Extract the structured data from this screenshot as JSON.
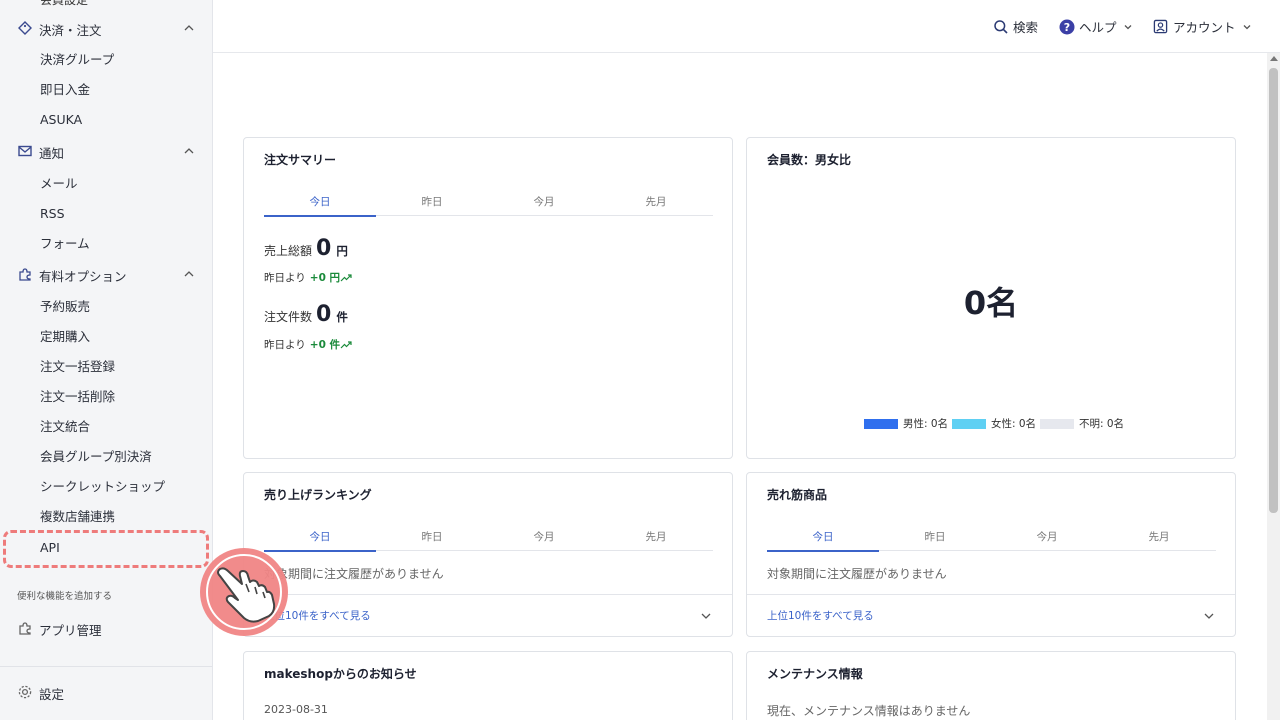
{
  "sidebar": {
    "cut_top_label": "会員設定",
    "sections": [
      {
        "label": "決済・注文",
        "icon": "tag-icon",
        "items": [
          "決済グループ",
          "即日入金",
          "ASUKA"
        ]
      },
      {
        "label": "通知",
        "icon": "mail-icon",
        "items": [
          "メール",
          "RSS",
          "フォーム"
        ]
      },
      {
        "label": "有料オプション",
        "icon": "puzzle-icon",
        "items": [
          "予約販売",
          "定期購入",
          "注文一括登録",
          "注文一括削除",
          "注文統合",
          "会員グループ別決済",
          "シークレットショップ",
          "複数店舗連携",
          "API"
        ]
      }
    ],
    "note": "便利な機能を追加する",
    "app_manage": "アプリ管理",
    "settings": "設定"
  },
  "header": {
    "search": "検索",
    "help": "ヘルプ",
    "account": "アカウント"
  },
  "order_summary": {
    "title": "注文サマリー",
    "tabs": [
      "今日",
      "昨日",
      "今月",
      "先月"
    ],
    "sales_label": "売上総額",
    "sales_value": "0",
    "sales_unit": "円",
    "sales_delta_prefix": "昨日より",
    "sales_delta": "+0 円",
    "orders_label": "注文件数",
    "orders_value": "0",
    "orders_unit": "件",
    "orders_delta_prefix": "昨日より",
    "orders_delta": "+0 件"
  },
  "members": {
    "title": "会員数：男女比",
    "total": "0名",
    "legend": [
      {
        "label": "男性: 0名",
        "color": "#2f6fee"
      },
      {
        "label": "女性: 0名",
        "color": "#5fd0f3"
      },
      {
        "label": "不明: 0名",
        "color": "#e6e8ee"
      }
    ]
  },
  "ranking": {
    "title": "売り上げランキング",
    "tabs": [
      "今日",
      "昨日",
      "今月",
      "先月"
    ],
    "empty": "対象期間に注文履歴がありません",
    "footer": "上位10件をすべて見る"
  },
  "best_sellers": {
    "title": "売れ筋商品",
    "tabs": [
      "今日",
      "昨日",
      "今月",
      "先月"
    ],
    "empty": "対象期間に注文履歴がありません",
    "footer": "上位10件をすべて見る"
  },
  "news": {
    "title": "makeshopからのお知らせ",
    "date": "2023-08-31"
  },
  "maintenance": {
    "title": "メンテナンス情報",
    "message": "現在、メンテナンス情報はありません"
  },
  "colors": {
    "accent": "#3b63c9",
    "positive": "#1a8a3a",
    "highlight": "#ee7b7b"
  }
}
